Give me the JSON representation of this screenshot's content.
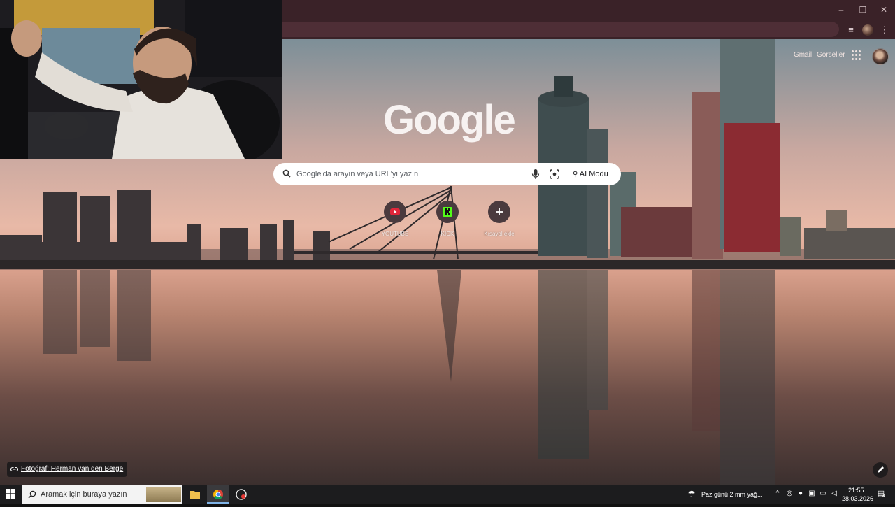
{
  "ntp": {
    "gmail_label": "Gmail",
    "images_label": "Görseller",
    "logo_text": "Google",
    "search_placeholder": "Google'da arayın veya URL'yi yazın",
    "ai_mode_label": "AI Modu",
    "shortcuts": [
      {
        "label": "YOUTUBE",
        "icon": "youtube-icon"
      },
      {
        "label": "KICK",
        "icon": "kick-icon"
      },
      {
        "label": "Kısayol ekle",
        "icon": "plus-icon"
      }
    ],
    "photo_credit": "Fotoğraf: Herman van den Berge"
  },
  "taskbar": {
    "search_placeholder": "Aramak için buraya yazın",
    "weather": "Paz günü 2 mm yağ...",
    "time": "21:55",
    "date": "28.03.2026",
    "notification_count": "4"
  },
  "colors": {
    "chrome_frame": "#3a2228",
    "taskbar": "#1c1c1e",
    "youtube_red": "#e0263a",
    "kick_green": "#53fc18"
  }
}
